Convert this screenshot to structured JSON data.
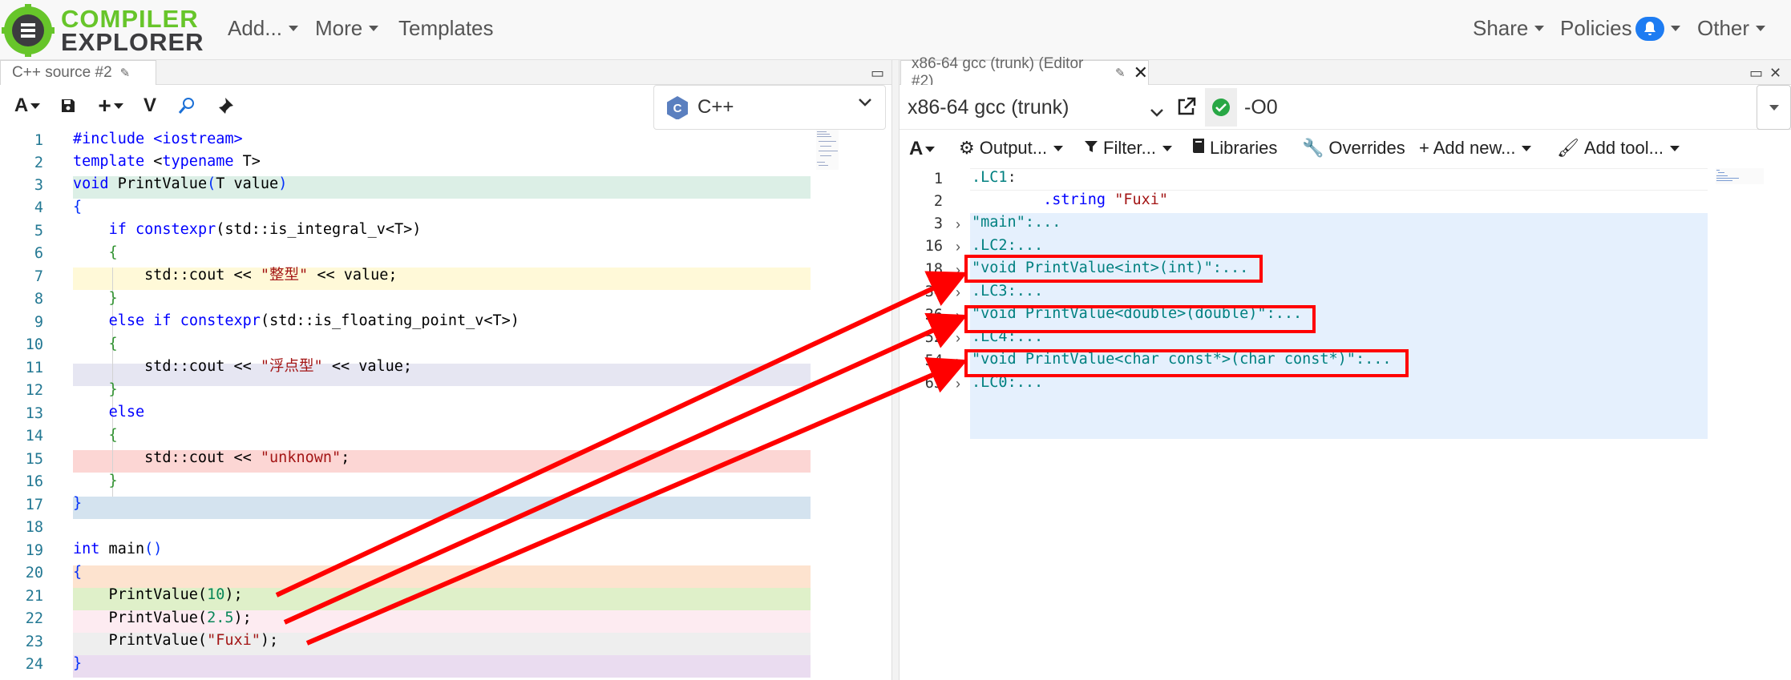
{
  "app": {
    "logo_line1": "COMPILER",
    "logo_line2": "EXPLORER",
    "menu": [
      {
        "label": "Add..."
      },
      {
        "label": "More"
      },
      {
        "label": "Templates"
      }
    ],
    "right_menu": [
      {
        "label": "Share"
      },
      {
        "label": "Policies"
      },
      {
        "label": "Other"
      }
    ],
    "brand_green": "#67c52a"
  },
  "source_pane": {
    "tab_label": "C++ source #2",
    "language": "C++",
    "toolbar_icons": [
      "font-icon",
      "save-icon",
      "add-icon",
      "vim-icon",
      "search-icon",
      "pin-icon"
    ],
    "lines": [
      {
        "n": "1"
      },
      {
        "n": "2"
      },
      {
        "n": "3"
      },
      {
        "n": "4"
      },
      {
        "n": "5"
      },
      {
        "n": "6"
      },
      {
        "n": "7"
      },
      {
        "n": "8"
      },
      {
        "n": "9"
      },
      {
        "n": "10"
      },
      {
        "n": "11"
      },
      {
        "n": "12"
      },
      {
        "n": "13"
      },
      {
        "n": "14"
      },
      {
        "n": "15"
      },
      {
        "n": "16"
      },
      {
        "n": "17"
      },
      {
        "n": "18"
      },
      {
        "n": "19"
      },
      {
        "n": "20"
      },
      {
        "n": "21"
      },
      {
        "n": "22"
      },
      {
        "n": "23"
      },
      {
        "n": "24"
      }
    ],
    "code": {
      "l1": "#include <iostream>",
      "l2a": "template",
      "l2b": " <",
      "l2c": "typename",
      "l2d": " T>",
      "l3a": "void",
      "l3b": " PrintValue",
      "l3c": "(",
      "l3d": "T value",
      "l3e": ")",
      "l4": "{",
      "l5a": "    ",
      "l5b": "if",
      "l5c": " ",
      "l5d": "constexpr",
      "l5e": "(std::is_integral_v<T>)",
      "l6": "    {",
      "l7a": "        std::cout << ",
      "l7b": "\"整型\"",
      "l7c": " << value;",
      "l8": "    }",
      "l9a": "    ",
      "l9b": "else",
      "l9c": " ",
      "l9d": "if",
      "l9e": " ",
      "l9f": "constexpr",
      "l9g": "(std::is_floating_point_v<T>)",
      "l10": "    {",
      "l11a": "        std::cout << ",
      "l11b": "\"浮点型\"",
      "l11c": " << value;",
      "l12": "    }",
      "l13a": "    ",
      "l13b": "else",
      "l14": "    {",
      "l15a": "        std::cout << ",
      "l15b": "\"unknown\"",
      "l15c": ";",
      "l16": "    }",
      "l17": "}",
      "l18": "",
      "l19a": "int",
      "l19b": " main",
      "l19c": "()",
      "l20": "{",
      "l21a": "    PrintValue(",
      "l21b": "10",
      "l21c": ");",
      "l22a": "    PrintValue(",
      "l22b": "2.5",
      "l22c": ");",
      "l23a": "    PrintValue(",
      "l23b": "\"Fuxi\"",
      "l23c": ");",
      "l24": "}"
    }
  },
  "compiler_pane": {
    "tab_label": "x86-64 gcc (trunk) (Editor #2)",
    "compiler": "x86-64 gcc (trunk)",
    "options": "-O0",
    "toolbar": [
      {
        "label": "Output..."
      },
      {
        "label": "Filter..."
      },
      {
        "label": "Libraries"
      },
      {
        "label": "Overrides"
      },
      {
        "label": "+ Add new..."
      },
      {
        "label": "Add tool..."
      }
    ],
    "asm_lines": [
      {
        "n": "1",
        "label": ".LC1",
        "suffix": ":"
      },
      {
        "n": "2",
        "label": "",
        "suffix": ""
      },
      {
        "n": "3",
        "label": "\"main\"",
        "suffix": ":..."
      },
      {
        "n": "16",
        "label": ".LC2",
        "suffix": ":..."
      },
      {
        "n": "18",
        "label": "\"void PrintValue<int>(int)\"",
        "suffix": ":..."
      },
      {
        "n": "34",
        "label": ".LC3",
        "suffix": ":..."
      },
      {
        "n": "36",
        "label": "\"void PrintValue<double>(double)\"",
        "suffix": ":..."
      },
      {
        "n": "52",
        "label": ".LC4",
        "suffix": ":..."
      },
      {
        "n": "54",
        "label": "\"void PrintValue<char const*>(char const*)\"",
        "suffix": ":..."
      },
      {
        "n": "65",
        "label": ".LC0",
        "suffix": ":..."
      }
    ],
    "string_directive": ".string",
    "string_value": "\"Fuxi\""
  },
  "annotation_color": "#ff0000"
}
